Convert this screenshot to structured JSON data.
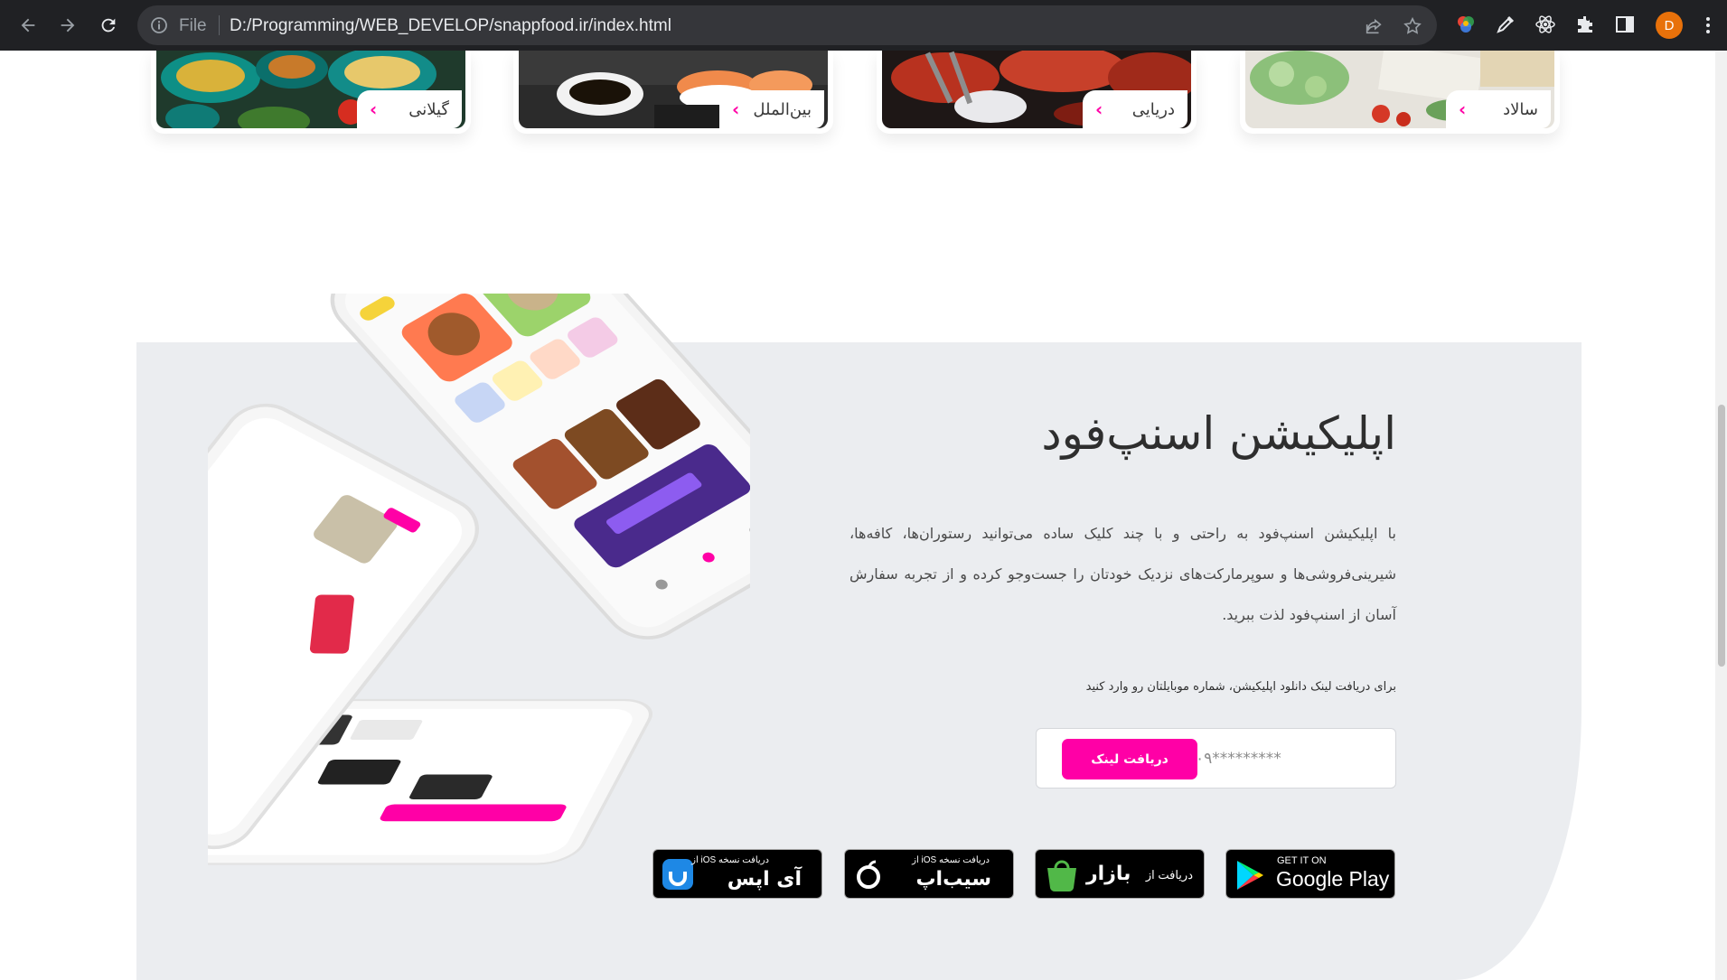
{
  "browser": {
    "url_scheme": "File",
    "url": "D:/Programming/WEB_DEVELOP/snappfood.ir/index.html",
    "profile_initial": "D",
    "colors": {
      "chrome_bg": "#202124",
      "omnibox_bg": "#35363a",
      "avatar": "#e8710a"
    }
  },
  "categories": [
    {
      "label": "گیلانی"
    },
    {
      "label": "بین‌الملل"
    },
    {
      "label": "دریایی"
    },
    {
      "label": "سالاد"
    }
  ],
  "app_section": {
    "title": "اپلیکیشن اسنپ‌فود",
    "description": "با اپلیکیشن اسنپ‌فود به راحتی و با چند کلیک ساده می‌توانید رستوران‌ها، کافه‌ها، شیرینی‌فروشی‌ها و سوپرمارکت‌های نزدیک خودتان را جست‌وجو کرده و از تجربه سفارش آسان از اسنپ‌فود لذت ببرید.",
    "prompt": "برای دریافت لینک دانلود اپلیکیشن، شماره موبایلتان رو وارد کنید",
    "phone_placeholder": "۰۹*********",
    "submit_label": "دریافت لینک",
    "accent_color": "#ff00a6",
    "stores": [
      {
        "small": "GET IT ON",
        "big": "Google Play",
        "icon": "google-play-icon"
      },
      {
        "small": "دریافت از",
        "big": "بازار",
        "icon": "bazaar-icon"
      },
      {
        "small": "دریافت نسخه iOS از",
        "big": "سیب‌اپ",
        "icon": "sibapp-icon"
      },
      {
        "small": "دریافت نسخه iOS از",
        "big": "آی اپس",
        "icon": "iapps-icon"
      }
    ]
  }
}
